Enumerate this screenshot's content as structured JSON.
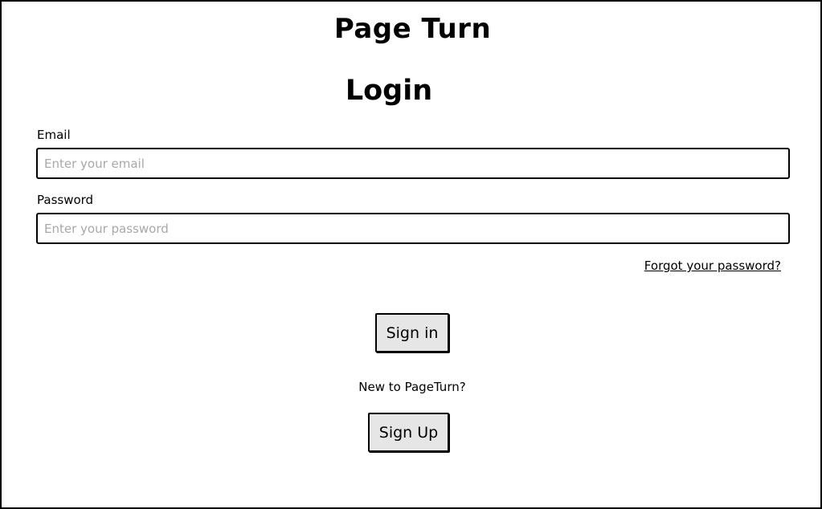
{
  "app": {
    "title": "Page Turn"
  },
  "login": {
    "heading": "Login",
    "email": {
      "label": "Email",
      "placeholder": "Enter your email",
      "value": ""
    },
    "password": {
      "label": "Password",
      "placeholder": "Enter your password",
      "value": ""
    },
    "forgot_password_label": "Forgot your password?",
    "sign_in_label": "Sign in",
    "new_user_text": "New to PageTurn?",
    "sign_up_label": "Sign Up"
  },
  "colors": {
    "button_background": "#e6e6e6",
    "border": "#000000",
    "placeholder": "#a8a8a8"
  }
}
